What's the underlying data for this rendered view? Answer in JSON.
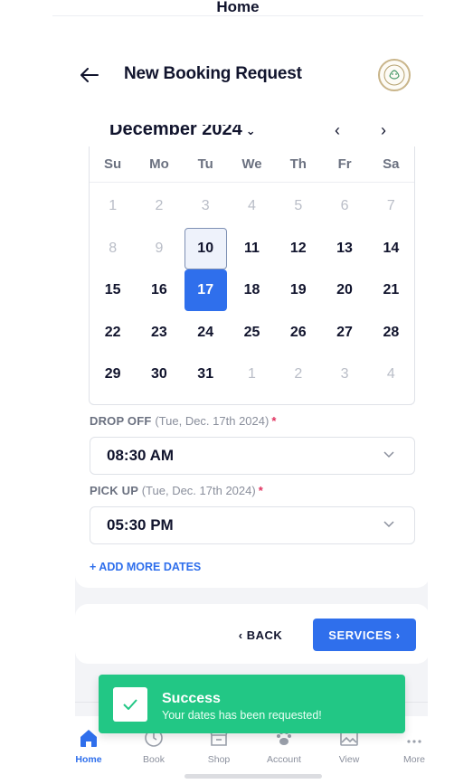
{
  "background_title": "Home",
  "header": {
    "title": "New Booking Request",
    "back_icon": "arrow-left-icon",
    "logo_icon": "business-logo"
  },
  "calendar": {
    "month_label": "December 2024",
    "prev_label": "‹",
    "next_label": "›",
    "weekdays": [
      "Su",
      "Mo",
      "Tu",
      "We",
      "Th",
      "Fr",
      "Sa"
    ],
    "weeks": [
      [
        "1",
        "2",
        "3",
        "4",
        "5",
        "6",
        "7"
      ],
      [
        "8",
        "9",
        "10",
        "11",
        "12",
        "13",
        "14"
      ],
      [
        "15",
        "16",
        "17",
        "18",
        "19",
        "20",
        "21"
      ],
      [
        "22",
        "23",
        "24",
        "25",
        "26",
        "27",
        "28"
      ],
      [
        "29",
        "30",
        "31",
        "1",
        "2",
        "3",
        "4"
      ]
    ],
    "today": "10",
    "selected": "17"
  },
  "drop_off": {
    "label": "DROP OFF",
    "date": "(Tue, Dec. 17th 2024)",
    "required_mark": "*",
    "value": "08:30 AM"
  },
  "pick_up": {
    "label": "PICK UP",
    "date": "(Tue, Dec. 17th 2024)",
    "required_mark": "*",
    "value": "05:30 PM"
  },
  "add_more_dates": "+ ADD MORE DATES",
  "actions": {
    "back_label": "‹ BACK",
    "services_label": "SERVICES ›"
  },
  "toast": {
    "title": "Success",
    "message": "Your dates has been requested!",
    "color": "#22c785"
  },
  "tabs": [
    {
      "label": "Home",
      "icon": "home-icon",
      "active": true
    },
    {
      "label": "Book",
      "icon": "clock-icon",
      "active": false
    },
    {
      "label": "Shop",
      "icon": "shop-icon",
      "active": false
    },
    {
      "label": "Account",
      "icon": "paw-icon",
      "active": false
    },
    {
      "label": "View",
      "icon": "image-icon",
      "active": false
    },
    {
      "label": "More",
      "icon": "more-icon",
      "active": false
    }
  ],
  "colors": {
    "accent": "#2f6fec",
    "required": "#e0325f",
    "text": "#11142d"
  }
}
